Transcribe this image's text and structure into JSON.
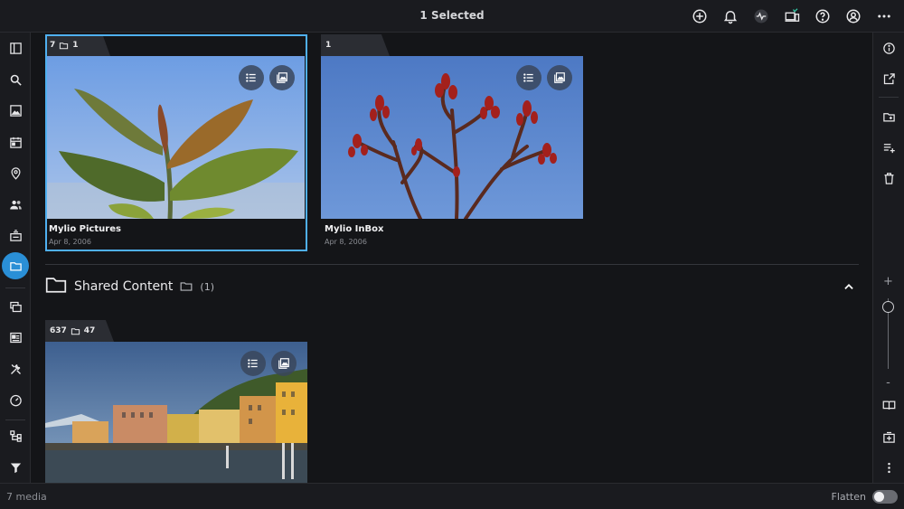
{
  "header": {
    "title": "1 Selected",
    "icons": [
      "add-icon",
      "bell-icon",
      "activity-icon",
      "devices-icon",
      "help-icon",
      "account-icon",
      "more-icon"
    ]
  },
  "left_sidebar": {
    "items": [
      "panel-toggle-icon",
      "search-icon",
      "photos-icon",
      "calendar-icon",
      "map-pin-icon",
      "people-icon",
      "import-icon",
      "folders-icon",
      "albums-icon",
      "dashboard-icon",
      "tools-icon",
      "speedometer-icon",
      "tree-icon",
      "filter-icon"
    ],
    "active": "folders-icon"
  },
  "right_sidebar": {
    "items": [
      "info-icon",
      "open-external-icon",
      "new-folder-icon",
      "add-to-list-icon",
      "trash-icon",
      "book-icon",
      "add-box-icon",
      "more-vertical-icon"
    ]
  },
  "folders": [
    {
      "name": "Mylio Pictures",
      "date": "Apr 8, 2006",
      "tab_count": "7",
      "tab_folders": "1",
      "selected": true
    },
    {
      "name": "Mylio InBox",
      "date": "Apr 8, 2006",
      "tab_count": "1",
      "tab_folders": "",
      "selected": false
    }
  ],
  "shared_section": {
    "title": "Shared Content",
    "count": "(1)",
    "folder": {
      "tab_count": "637",
      "tab_folders": "47"
    }
  },
  "zoom": {
    "plus": "+",
    "minus": "-",
    "level": 0.04
  },
  "footer": {
    "media_count": "7 media",
    "flatten_label": "Flatten",
    "flatten_on": false
  },
  "colors": {
    "accent": "#2a8fd6",
    "selection": "#4fb0f0",
    "background": "#141518"
  }
}
